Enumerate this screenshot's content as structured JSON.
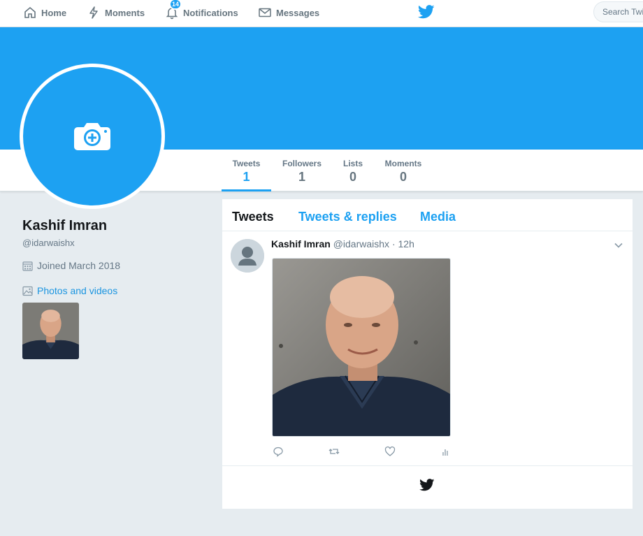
{
  "nav": {
    "home": "Home",
    "moments": "Moments",
    "notifications": "Notifications",
    "notifications_count": "14",
    "messages": "Messages",
    "search_placeholder": "Search Twitter"
  },
  "profile": {
    "name": "Kashif Imran",
    "handle": "@idarwaishx",
    "joined": "Joined March 2018",
    "photos_label": "Photos and videos"
  },
  "stats": [
    {
      "label": "Tweets",
      "value": "1"
    },
    {
      "label": "Followers",
      "value": "1"
    },
    {
      "label": "Lists",
      "value": "0"
    },
    {
      "label": "Moments",
      "value": "0"
    }
  ],
  "timeline": {
    "tabs": [
      "Tweets",
      "Tweets & replies",
      "Media"
    ],
    "tweet": {
      "name": "Kashif Imran",
      "handle": "@idarwaishx",
      "separator": "·",
      "time": "12h"
    }
  },
  "colors": {
    "brand": "#1da1f2",
    "link": "#1b95e0",
    "background": "#e6ecf0"
  },
  "icons": [
    "home-icon",
    "lightning-icon",
    "bell-icon",
    "envelope-icon",
    "bird-icon",
    "camera-plus-icon",
    "calendar-icon",
    "image-icon",
    "chevron-down-icon",
    "reply-icon",
    "retweet-icon",
    "heart-icon",
    "analytics-icon"
  ]
}
